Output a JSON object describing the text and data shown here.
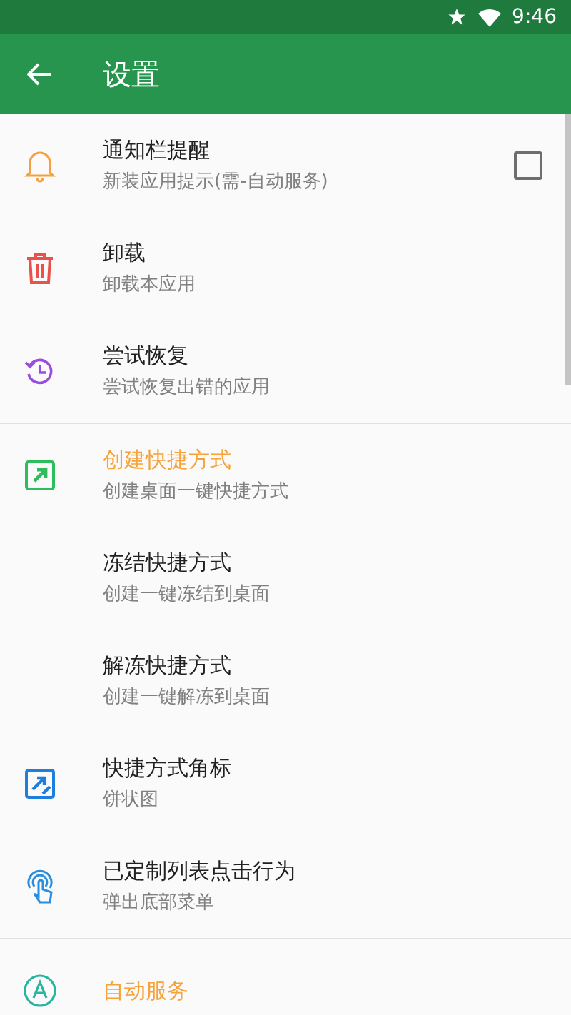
{
  "status_bar": {
    "time": "9:46"
  },
  "toolbar": {
    "title": "设置"
  },
  "sections": [
    {
      "items": [
        {
          "title": "通知栏提醒",
          "subtitle": "新装应用提示(需-自动服务)",
          "accent": false,
          "kind": "checkbox",
          "checked": false
        },
        {
          "title": "卸载",
          "subtitle": "卸载本应用",
          "accent": false,
          "kind": "plain"
        },
        {
          "title": "尝试恢复",
          "subtitle": "尝试恢复出错的应用",
          "accent": false,
          "kind": "plain"
        }
      ]
    },
    {
      "items": [
        {
          "title": "创建快捷方式",
          "subtitle": "创建桌面一键快捷方式",
          "accent": true,
          "kind": "plain"
        },
        {
          "title": "冻结快捷方式",
          "subtitle": "创建一键冻结到桌面",
          "accent": false,
          "kind": "plain"
        },
        {
          "title": "解冻快捷方式",
          "subtitle": "创建一键解冻到桌面",
          "accent": false,
          "kind": "plain"
        },
        {
          "title": "快捷方式角标",
          "subtitle": "饼状图",
          "accent": false,
          "kind": "plain"
        },
        {
          "title": "已定制列表点击行为",
          "subtitle": "弹出底部菜单",
          "accent": false,
          "kind": "plain"
        }
      ]
    },
    {
      "items": [
        {
          "title": "自动服务",
          "accent": true,
          "kind": "plain"
        }
      ]
    }
  ]
}
